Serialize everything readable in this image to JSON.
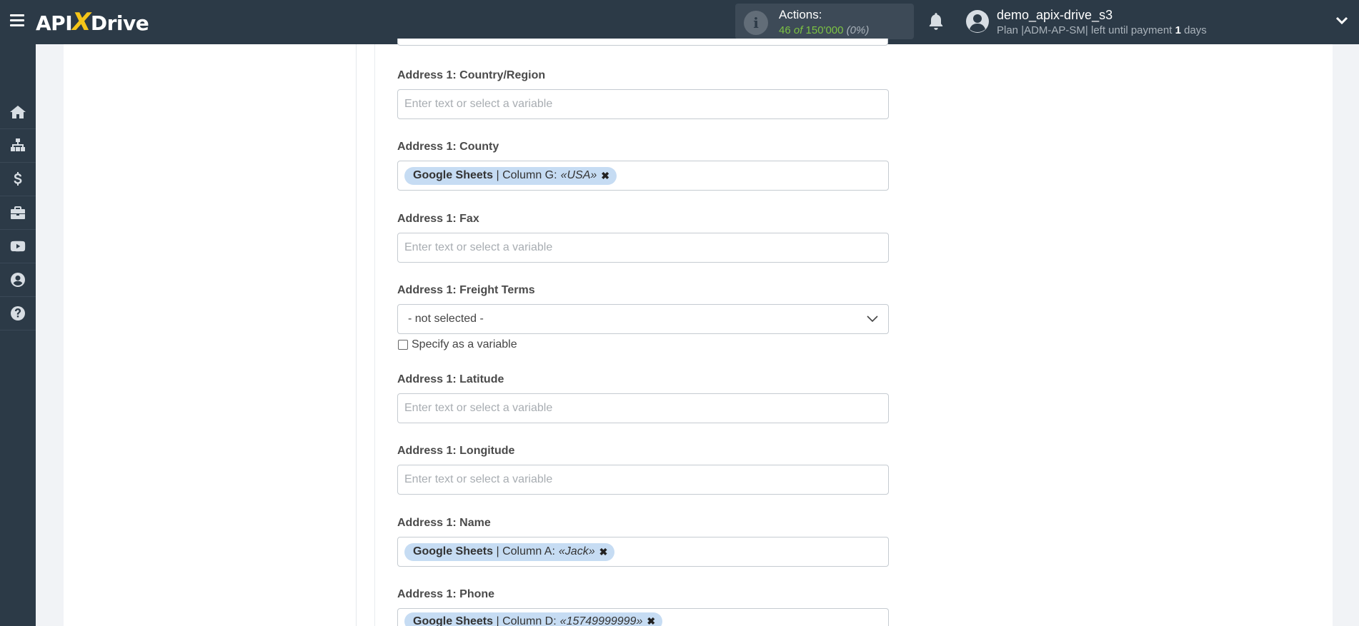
{
  "header": {
    "logo": {
      "left": "API",
      "x": "X",
      "right": "Drive"
    },
    "actions": {
      "label": "Actions:",
      "used": "46",
      "of": "of",
      "total": "150'000",
      "percent": "(0%)"
    },
    "user": {
      "name": "demo_apix-drive_s3",
      "plan_prefix": "Plan |ADM-AP-SM| left until payment",
      "days_number": "1",
      "days_suffix": "days"
    }
  },
  "sidebar": {
    "items": [
      "home-icon",
      "sitemap-icon",
      "dollar-icon",
      "briefcase-icon",
      "youtube-icon",
      "user-circle-icon",
      "question-circle-icon"
    ]
  },
  "form": {
    "placeholder": "Enter text or select a variable",
    "fields": {
      "country": {
        "label": "Address 1: Country/Region"
      },
      "county": {
        "label": "Address 1: County",
        "tag_source": "Google Sheets",
        "tag_column": "| Column G:",
        "tag_value": "«USA»"
      },
      "fax": {
        "label": "Address 1: Fax"
      },
      "freight": {
        "label": "Address 1: Freight Terms",
        "selected": "- not selected -",
        "checkbox_label": "Specify as a variable"
      },
      "latitude": {
        "label": "Address 1: Latitude"
      },
      "longitude": {
        "label": "Address 1: Longitude"
      },
      "name": {
        "label": "Address 1: Name",
        "tag_source": "Google Sheets",
        "tag_column": "| Column A:",
        "tag_value": "«Jack»"
      },
      "phone": {
        "label": "Address 1: Phone",
        "tag_source": "Google Sheets",
        "tag_column": "| Column D:",
        "tag_value": "«15749999999»"
      }
    }
  },
  "colors": {
    "topbar": "#2c3a47",
    "accent_green": "#7cc243",
    "tag_bg": "#c6dcf3",
    "logo_x": "#f5c518"
  }
}
